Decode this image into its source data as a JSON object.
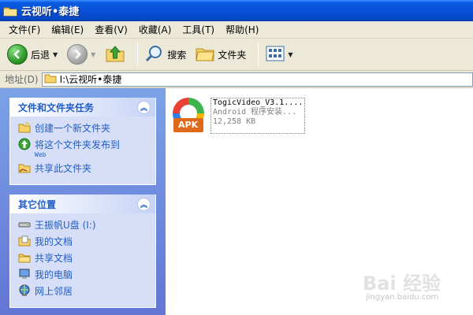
{
  "window": {
    "title": "云视听•泰捷",
    "icon": "folder-icon"
  },
  "menu": {
    "items": [
      "文件(F)",
      "编辑(E)",
      "查看(V)",
      "收藏(A)",
      "工具(T)",
      "帮助(H)"
    ]
  },
  "toolbar": {
    "back_label": "后退",
    "search_label": "搜索",
    "folders_label": "文件夹"
  },
  "address": {
    "label": "地址(D)",
    "path": "I:\\云视听•泰捷"
  },
  "file_tasks": {
    "title": "文件和文件夹任务",
    "items": [
      {
        "label": "创建一个新文件夹",
        "icon": "new-folder-icon"
      },
      {
        "label": "将这个文件夹发布到",
        "sub": "Web",
        "icon": "publish-web-icon"
      },
      {
        "label": "共享此文件夹",
        "icon": "share-folder-icon"
      }
    ]
  },
  "other_places": {
    "title": "其它位置",
    "items": [
      {
        "label": "王振帆U盘 (I:)",
        "icon": "drive-icon"
      },
      {
        "label": "我的文档",
        "icon": "my-documents-icon"
      },
      {
        "label": "共享文档",
        "icon": "shared-documents-icon"
      },
      {
        "label": "我的电脑",
        "icon": "my-computer-icon"
      },
      {
        "label": "网上邻居",
        "icon": "network-icon"
      }
    ]
  },
  "files": [
    {
      "name": "TogicVideo_V3.1....",
      "type": "Android 程序安装...",
      "size": "12,258 KB",
      "badge": "APK",
      "icon": "apk-file-icon"
    }
  ],
  "watermark": {
    "text": "Bai 经验",
    "url": "jingyan.baidu.com"
  },
  "colors": {
    "titlebar": "#0a5be0",
    "task_link": "#215dc6",
    "left_pane": "#7ba2e7",
    "chrome": "#ece9d8"
  }
}
